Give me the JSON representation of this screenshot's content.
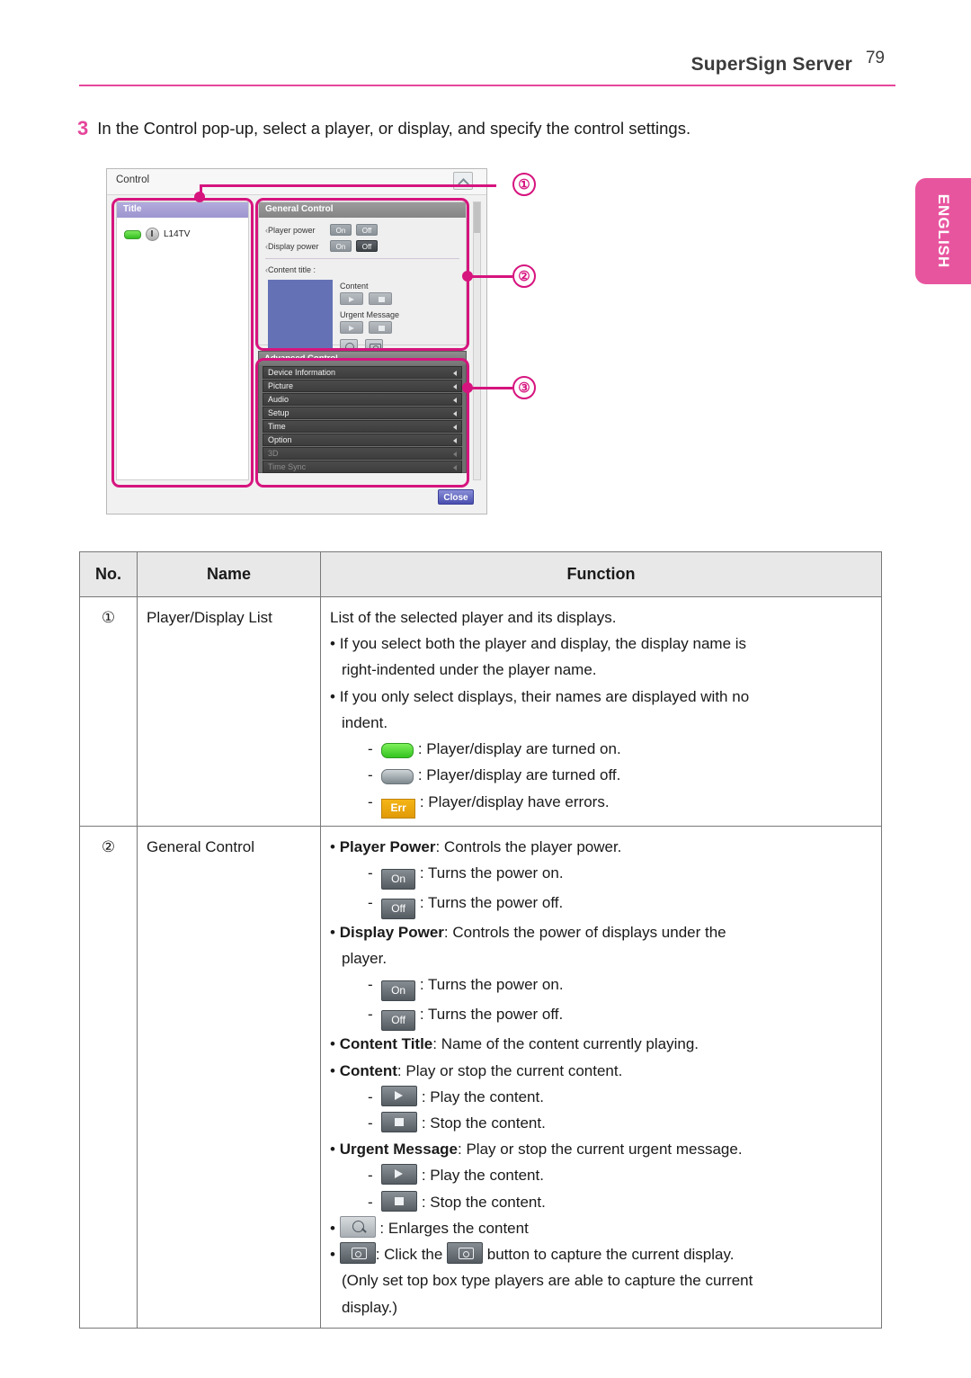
{
  "header": {
    "title": "SuperSign Server",
    "page_number": "79",
    "language_tab": "ENGLISH"
  },
  "step": {
    "number": "3",
    "text": "In the Control pop-up, select a player, or display, and specify the control settings."
  },
  "screenshot": {
    "window_title": "Control",
    "collapse_icon": "chevron-up-icon",
    "close_button": "Close",
    "title_panel": {
      "header": "Title",
      "player_name": "L14TV",
      "status_icon": "status-pill-on-icon",
      "power_icon": "power-icon"
    },
    "general_control": {
      "header": "General Control",
      "player_power_label": "Player power",
      "display_power_label": "Display power",
      "on_label": "On",
      "off_label": "Off",
      "content_title_label": "Content title :",
      "content_label": "Content",
      "urgent_message_label": "Urgent Message",
      "play_icon": "play-icon",
      "stop_icon": "stop-icon",
      "magnify_icon": "magnify-icon",
      "camera_icon": "camera-icon"
    },
    "advanced_control": {
      "header": "Advanced Control",
      "items": [
        {
          "label": "Device Information",
          "disabled": false
        },
        {
          "label": "Picture",
          "disabled": false
        },
        {
          "label": "Audio",
          "disabled": false
        },
        {
          "label": "Setup",
          "disabled": false
        },
        {
          "label": "Time",
          "disabled": false
        },
        {
          "label": "Option",
          "disabled": false
        },
        {
          "label": "3D",
          "disabled": true
        },
        {
          "label": "Time Sync",
          "disabled": true
        }
      ]
    }
  },
  "callouts": [
    {
      "number": "①"
    },
    {
      "number": "②"
    },
    {
      "number": "③"
    }
  ],
  "table": {
    "headers": {
      "no": "No.",
      "name": "Name",
      "function": "Function"
    },
    "rows": [
      {
        "no": "①",
        "name": "Player/Display List",
        "lines": [
          {
            "kind": "plain",
            "text": "List of the selected player and its displays."
          },
          {
            "kind": "bullet",
            "text": "If you select both the player and display, the display name is"
          },
          {
            "kind": "cont",
            "text": "right-indented under the player name."
          },
          {
            "kind": "bullet",
            "text": "If you only select displays, their names are displayed with no"
          },
          {
            "kind": "cont",
            "text": "indent."
          },
          {
            "kind": "dash-chip",
            "chip": "pill-on",
            "text": ": Player/display are turned on."
          },
          {
            "kind": "dash-chip",
            "chip": "pill-off",
            "text": ": Player/display are turned off."
          },
          {
            "kind": "dash-chip",
            "chip": "err",
            "chip_label": "Err",
            "text": ": Player/display have errors."
          }
        ]
      },
      {
        "no": "②",
        "name": "General Control",
        "lines": [
          {
            "kind": "bullet-bold",
            "bold": "Player Power",
            "text": ": Controls the player power."
          },
          {
            "kind": "dash-chip",
            "chip": "btn",
            "chip_label": "On",
            "text": ": Turns the power on."
          },
          {
            "kind": "dash-chip",
            "chip": "btn",
            "chip_label": "Off",
            "text": ": Turns the power off."
          },
          {
            "kind": "bullet-bold",
            "bold": "Display Power",
            "text": ": Controls the power of displays under the"
          },
          {
            "kind": "cont",
            "text": "player."
          },
          {
            "kind": "dash-chip",
            "chip": "btn",
            "chip_label": "On",
            "text": ": Turns the power on."
          },
          {
            "kind": "dash-chip",
            "chip": "btn",
            "chip_label": "Off",
            "text": ": Turns the power off."
          },
          {
            "kind": "bullet-bold",
            "bold": "Content Title",
            "text": ": Name of the content currently playing."
          },
          {
            "kind": "bullet-bold",
            "bold": "Content",
            "text": ": Play or stop the current content."
          },
          {
            "kind": "dash-chip",
            "chip": "play",
            "text": ": Play the content."
          },
          {
            "kind": "dash-chip",
            "chip": "stop",
            "text": ": Stop the content."
          },
          {
            "kind": "bullet-bold",
            "bold": "Urgent Message",
            "text": ": Play or stop the current urgent message."
          },
          {
            "kind": "dash-chip",
            "chip": "play",
            "text": ": Play the content."
          },
          {
            "kind": "dash-chip",
            "chip": "stop",
            "text": ": Stop the content."
          },
          {
            "kind": "bullet-chip",
            "chip": "mag",
            "text": ": Enlarges the content"
          },
          {
            "kind": "bullet-chip2",
            "chip": "cam",
            "text_a": ": Click the ",
            "chip2": "cam",
            "text_b": " button to capture the current display."
          },
          {
            "kind": "cont",
            "text": "(Only set top box type players are able to capture the current"
          },
          {
            "kind": "cont",
            "text": "display.)"
          }
        ]
      }
    ]
  },
  "colors": {
    "accent_pink": "#e5469b",
    "callout_pink": "#d6147e",
    "tab_pink": "#e8559f",
    "table_header_bg": "#e8e8e8",
    "preview_blue": "#6471b5",
    "status_green": "#34c41f",
    "error_orange": "#e09a06"
  }
}
